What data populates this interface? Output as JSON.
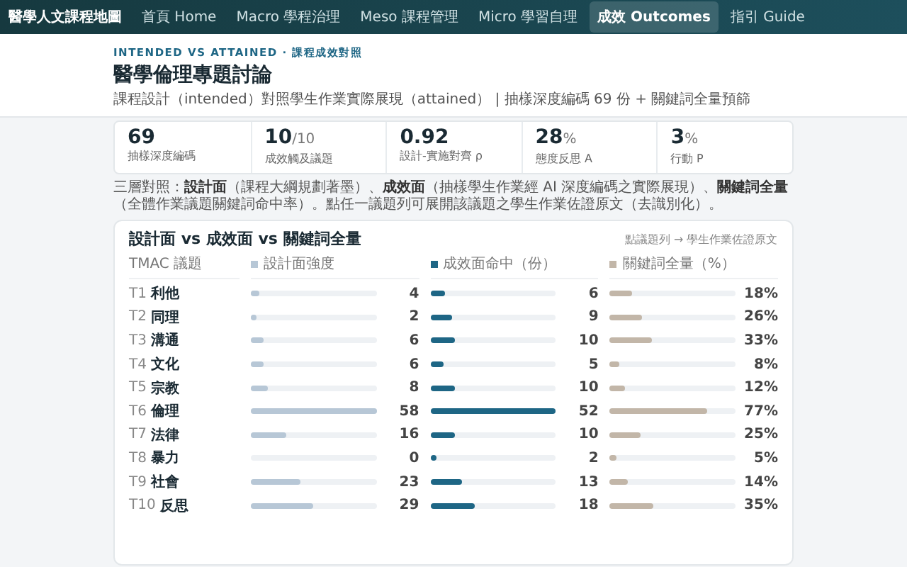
{
  "nav": {
    "brand": "醫學人文課程地圖",
    "items": [
      {
        "label": "首頁 Home",
        "selected": false
      },
      {
        "label": "Macro 學程治理",
        "selected": false
      },
      {
        "label": "Meso 課程管理",
        "selected": false
      },
      {
        "label": "Micro 學習自理",
        "selected": false
      },
      {
        "label": "成效 Outcomes",
        "selected": true
      },
      {
        "label": "指引 Guide",
        "selected": false
      }
    ]
  },
  "header": {
    "eyebrow": "INTENDED VS ATTAINED · 課程成效對照",
    "title": "醫學倫理專題討論",
    "subtitle": "課程設計（intended）對照學生作業實際展現（attained） | 抽樣深度編碼 69 份 + 關鍵詞全量預篩"
  },
  "stats": [
    {
      "value": "69",
      "label": "抽樣深度編碼"
    },
    {
      "value": "10",
      "unit": "/10",
      "label": "成效觸及議題"
    },
    {
      "value": "0.92",
      "label": "設計-實施對齊 ρ"
    },
    {
      "value": "28",
      "unit": "%",
      "label": "態度反思 A"
    },
    {
      "value": "3",
      "unit": "%",
      "label": "行動 P"
    }
  ],
  "note": "三層對照：**設計面**（課程大綱規劃著墨）、**成效面**（抽樣學生作業經 AI 深度編碼之實際展現）、**關鍵詞全量**（全體作業議題關鍵詞命中率）。點任一議題列可展開該議題之學生作業佐證原文（去識別化）。",
  "chart": {
    "title": "設計面 vs 成效面 vs 關鍵詞全量",
    "hint": "點議題列 → 學生作業佐證原文",
    "columns": [
      {
        "label": "TMAC 議題"
      },
      {
        "label": "設計面強度",
        "color": "#b7c7d6"
      },
      {
        "label": "成效面命中（份）",
        "color": "#1e6685"
      },
      {
        "label": "關鍵詞全量（%）",
        "color": "#c2b6a8"
      }
    ],
    "rows": [
      {
        "code": "T1",
        "name": "利他",
        "design": {
          "value": "4",
          "level": 0.07
        },
        "hits": {
          "value": "6",
          "level": 0.12
        },
        "keyword": {
          "value": "18%",
          "level": 0.18
        }
      },
      {
        "code": "T2",
        "name": "同理",
        "design": {
          "value": "2",
          "level": 0.03
        },
        "hits": {
          "value": "9",
          "level": 0.17
        },
        "keyword": {
          "value": "26%",
          "level": 0.26
        }
      },
      {
        "code": "T3",
        "name": "溝通",
        "design": {
          "value": "6",
          "level": 0.1
        },
        "hits": {
          "value": "10",
          "level": 0.19
        },
        "keyword": {
          "value": "33%",
          "level": 0.33
        }
      },
      {
        "code": "T4",
        "name": "文化",
        "design": {
          "value": "6",
          "level": 0.1
        },
        "hits": {
          "value": "5",
          "level": 0.1
        },
        "keyword": {
          "value": "8%",
          "level": 0.08
        }
      },
      {
        "code": "T5",
        "name": "宗教",
        "design": {
          "value": "8",
          "level": 0.14
        },
        "hits": {
          "value": "10",
          "level": 0.19
        },
        "keyword": {
          "value": "12%",
          "level": 0.12
        }
      },
      {
        "code": "T6",
        "name": "倫理",
        "design": {
          "value": "58",
          "level": 1
        },
        "hits": {
          "value": "52",
          "level": 1
        },
        "keyword": {
          "value": "77%",
          "level": 0.77
        }
      },
      {
        "code": "T7",
        "name": "法律",
        "design": {
          "value": "16",
          "level": 0.28
        },
        "hits": {
          "value": "10",
          "level": 0.19
        },
        "keyword": {
          "value": "25%",
          "level": 0.25
        }
      },
      {
        "code": "T8",
        "name": "暴力",
        "design": {
          "value": "0",
          "level": 0
        },
        "hits": {
          "value": "2",
          "level": 0.04
        },
        "keyword": {
          "value": "5%",
          "level": 0.05
        }
      },
      {
        "code": "T9",
        "name": "社會",
        "design": {
          "value": "23",
          "level": 0.4
        },
        "hits": {
          "value": "13",
          "level": 0.25
        },
        "keyword": {
          "value": "14%",
          "level": 0.14
        }
      },
      {
        "code": "T10",
        "name": "反思",
        "design": {
          "value": "29",
          "level": 0.5
        },
        "hits": {
          "value": "18",
          "level": 0.35
        },
        "keyword": {
          "value": "35%",
          "level": 0.35
        }
      }
    ]
  }
}
